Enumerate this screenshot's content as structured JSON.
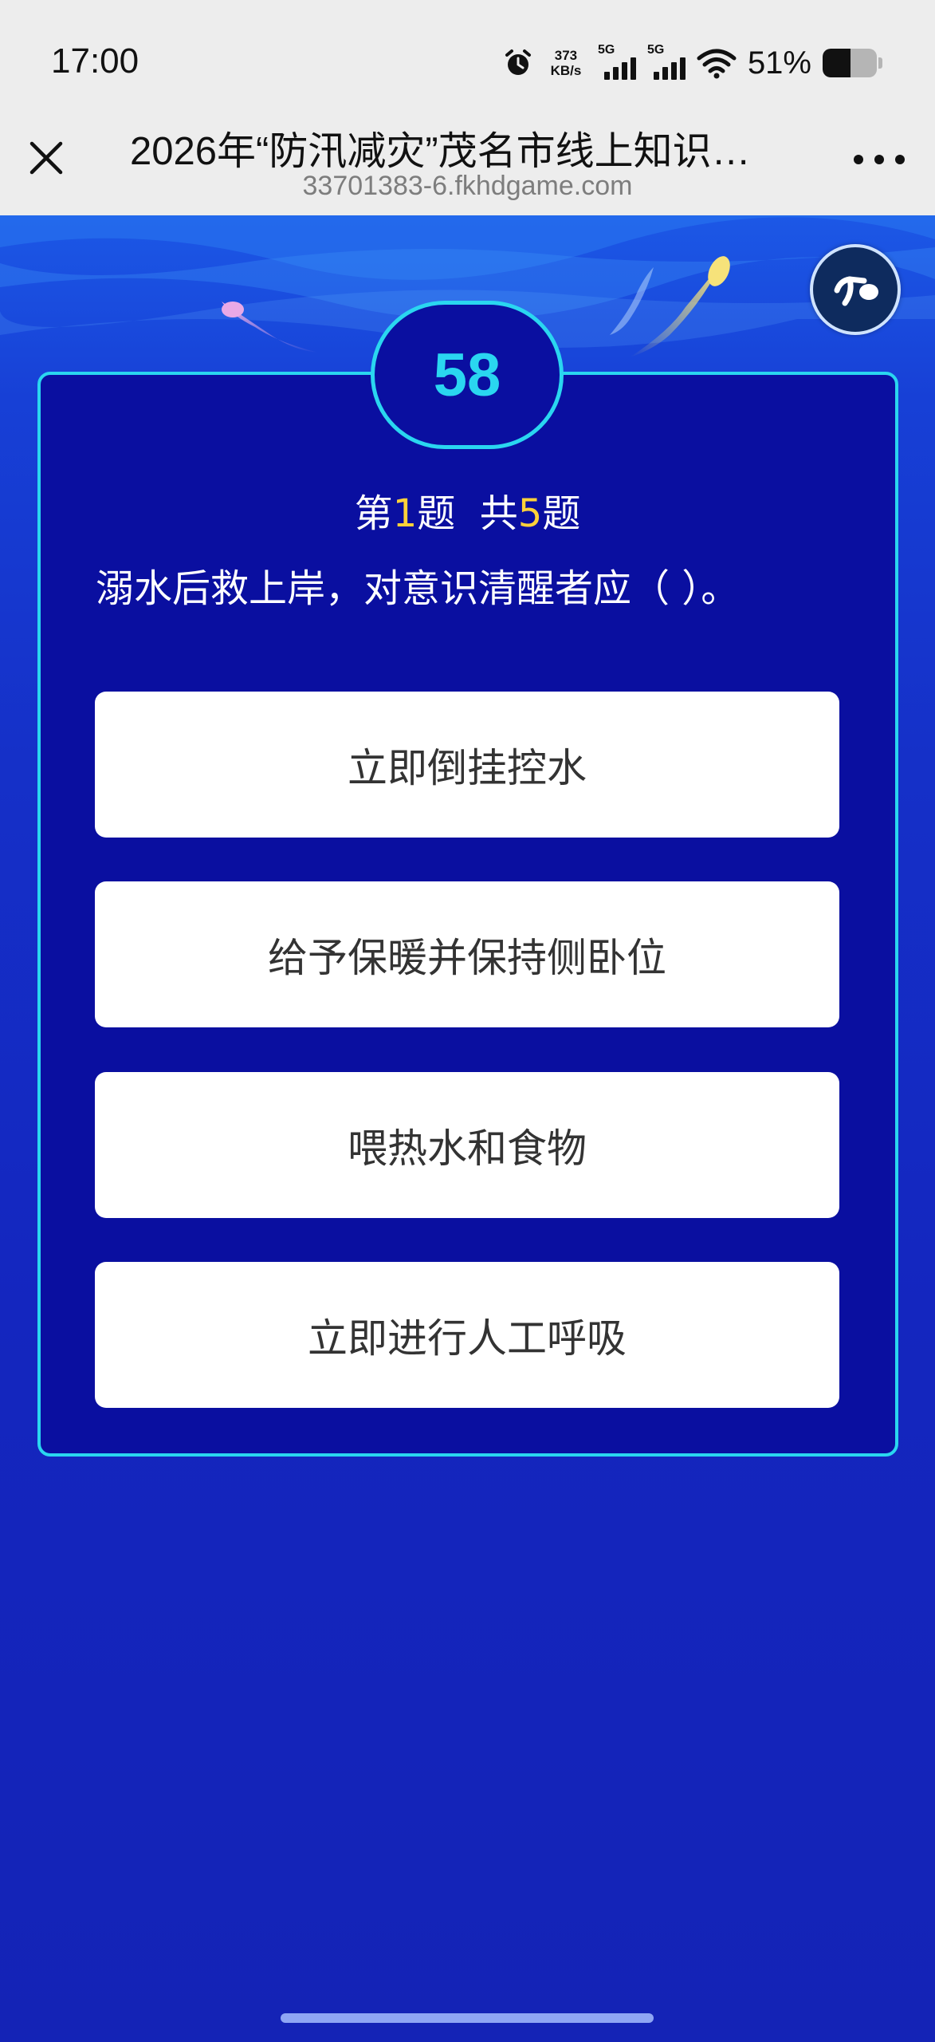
{
  "status_bar": {
    "time": "17:00",
    "net_speed_value": "373",
    "net_speed_unit": "KB/s",
    "sim1_label": "5G",
    "sim2_label": "5G",
    "battery_percent": "51%",
    "battery_level": 0.51,
    "icons": [
      "alarm-icon",
      "signal-icon",
      "signal-icon",
      "wifi-icon",
      "battery-icon"
    ]
  },
  "title_bar": {
    "title": "2026年“防汛减灾”茂名市线上知识…",
    "url": "33701383-6.fkhdgame.com",
    "close_icon": "close-icon",
    "more_icon": "more-icon"
  },
  "quiz": {
    "timer": "58",
    "progress_prefix": "第",
    "current": "1",
    "progress_mid": "题  共",
    "total": "5",
    "progress_suffix": "题",
    "question": "溺水后救上岸，对意识清醒者应（ ）。",
    "options": [
      "立即倒挂控水",
      "给予保暖并保持侧卧位",
      "喂热水和食物",
      "立即进行人工呼吸"
    ],
    "music_icon": "music-note-icon"
  },
  "colors": {
    "panel_bg": "#0a0fa0",
    "accent": "#2ad6f0",
    "highlight": "#ffd23a",
    "page_bg": "#1526b8"
  }
}
